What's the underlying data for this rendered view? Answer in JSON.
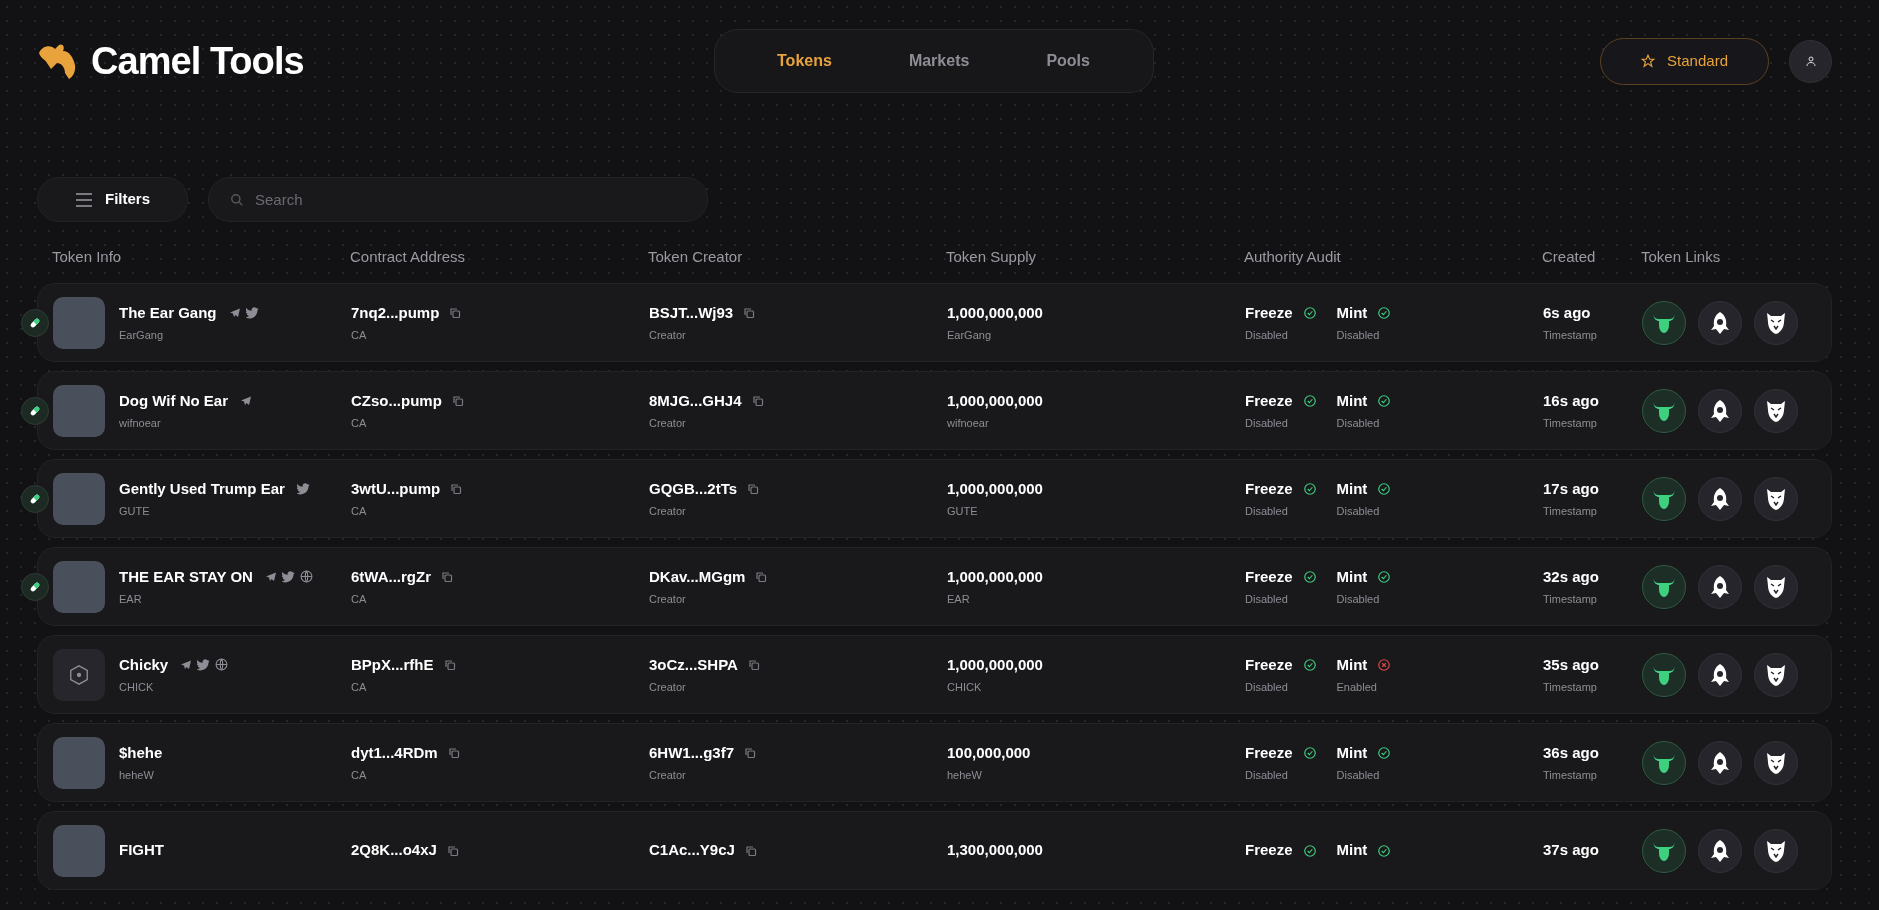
{
  "brand": {
    "name": "Camel Tools"
  },
  "nav": [
    {
      "label": "Tokens",
      "selected": true
    },
    {
      "label": "Markets",
      "selected": false
    },
    {
      "label": "Pools",
      "selected": false
    }
  ],
  "plan_button": {
    "label": "Standard"
  },
  "filters_button": {
    "label": "Filters"
  },
  "search": {
    "placeholder": "Search"
  },
  "table": {
    "columns": [
      "Token Info",
      "Contract Address",
      "Token Creator",
      "Token Supply",
      "Authority Audit",
      "Created",
      "Token Links"
    ],
    "rows": [
      {
        "name": "The Ear Gang",
        "symbol": "EarGang",
        "photo": true,
        "pill": true,
        "socials": [
          {
            "kind": "telegram"
          },
          {
            "kind": "twitter"
          }
        ],
        "contract": "7nq2...pump",
        "contract_label": "CA",
        "creator": "BSJT...Wj93",
        "creator_label": "Creator",
        "supply": "1,000,000,000",
        "supply_label": "EarGang",
        "audit": [
          {
            "label": "Freeze",
            "status": "Disabled",
            "ok": true
          },
          {
            "label": "Mint",
            "status": "Disabled",
            "ok": true
          }
        ],
        "created": "6s ago",
        "created_label": "Timestamp"
      },
      {
        "name": "Dog Wif No Ear",
        "symbol": "wifnoear",
        "photo": true,
        "pill": true,
        "socials": [
          {
            "kind": "telegram"
          }
        ],
        "contract": "CZso...pump",
        "contract_label": "CA",
        "creator": "8MJG...GHJ4",
        "creator_label": "Creator",
        "supply": "1,000,000,000",
        "supply_label": "wifnoear",
        "audit": [
          {
            "label": "Freeze",
            "status": "Disabled",
            "ok": true
          },
          {
            "label": "Mint",
            "status": "Disabled",
            "ok": true
          }
        ],
        "created": "16s ago",
        "created_label": "Timestamp"
      },
      {
        "name": "Gently Used Trump Ear",
        "symbol": "GUTE",
        "photo": true,
        "pill": true,
        "socials": [
          {
            "kind": "twitter"
          }
        ],
        "contract": "3wtU...pump",
        "contract_label": "CA",
        "creator": "GQGB...2tTs",
        "creator_label": "Creator",
        "supply": "1,000,000,000",
        "supply_label": "GUTE",
        "audit": [
          {
            "label": "Freeze",
            "status": "Disabled",
            "ok": true
          },
          {
            "label": "Mint",
            "status": "Disabled",
            "ok": true
          }
        ],
        "created": "17s ago",
        "created_label": "Timestamp"
      },
      {
        "name": "THE EAR STAY ON",
        "symbol": "EAR",
        "photo": true,
        "pill": true,
        "socials": [
          {
            "kind": "telegram"
          },
          {
            "kind": "twitter"
          },
          {
            "kind": "web"
          }
        ],
        "contract": "6tWA...rgZr",
        "contract_label": "CA",
        "creator": "DKav...MGgm",
        "creator_label": "Creator",
        "supply": "1,000,000,000",
        "supply_label": "EAR",
        "audit": [
          {
            "label": "Freeze",
            "status": "Disabled",
            "ok": true
          },
          {
            "label": "Mint",
            "status": "Disabled",
            "ok": true
          }
        ],
        "created": "32s ago",
        "created_label": "Timestamp"
      },
      {
        "name": "Chicky",
        "symbol": "CHICK",
        "photo": false,
        "pill": false,
        "socials": [
          {
            "kind": "telegram"
          },
          {
            "kind": "twitter"
          },
          {
            "kind": "web"
          }
        ],
        "contract": "BPpX...rfhE",
        "contract_label": "CA",
        "creator": "3oCz...SHPA",
        "creator_label": "Creator",
        "supply": "1,000,000,000",
        "supply_label": "CHICK",
        "audit": [
          {
            "label": "Freeze",
            "status": "Disabled",
            "ok": true
          },
          {
            "label": "Mint",
            "status": "Enabled",
            "ok": false
          }
        ],
        "created": "35s ago",
        "created_label": "Timestamp"
      },
      {
        "name": "$hehe",
        "symbol": "heheW",
        "photo": true,
        "pill": false,
        "socials": [],
        "contract": "dyt1...4RDm",
        "contract_label": "CA",
        "creator": "6HW1...g3f7",
        "creator_label": "Creator",
        "supply": "100,000,000",
        "supply_label": "heheW",
        "audit": [
          {
            "label": "Freeze",
            "status": "Disabled",
            "ok": true
          },
          {
            "label": "Mint",
            "status": "Disabled",
            "ok": true
          }
        ],
        "created": "36s ago",
        "created_label": "Timestamp"
      },
      {
        "name": "FIGHT",
        "photo": true,
        "pill": false,
        "socials": [],
        "contract": "2Q8K...o4xJ",
        "creator": "C1Ac...Y9cJ",
        "supply": "1,300,000,000",
        "audit": [
          {
            "label": "Freeze",
            "ok": true
          },
          {
            "label": "Mint",
            "ok": true
          }
        ],
        "created": "37s ago"
      }
    ]
  }
}
